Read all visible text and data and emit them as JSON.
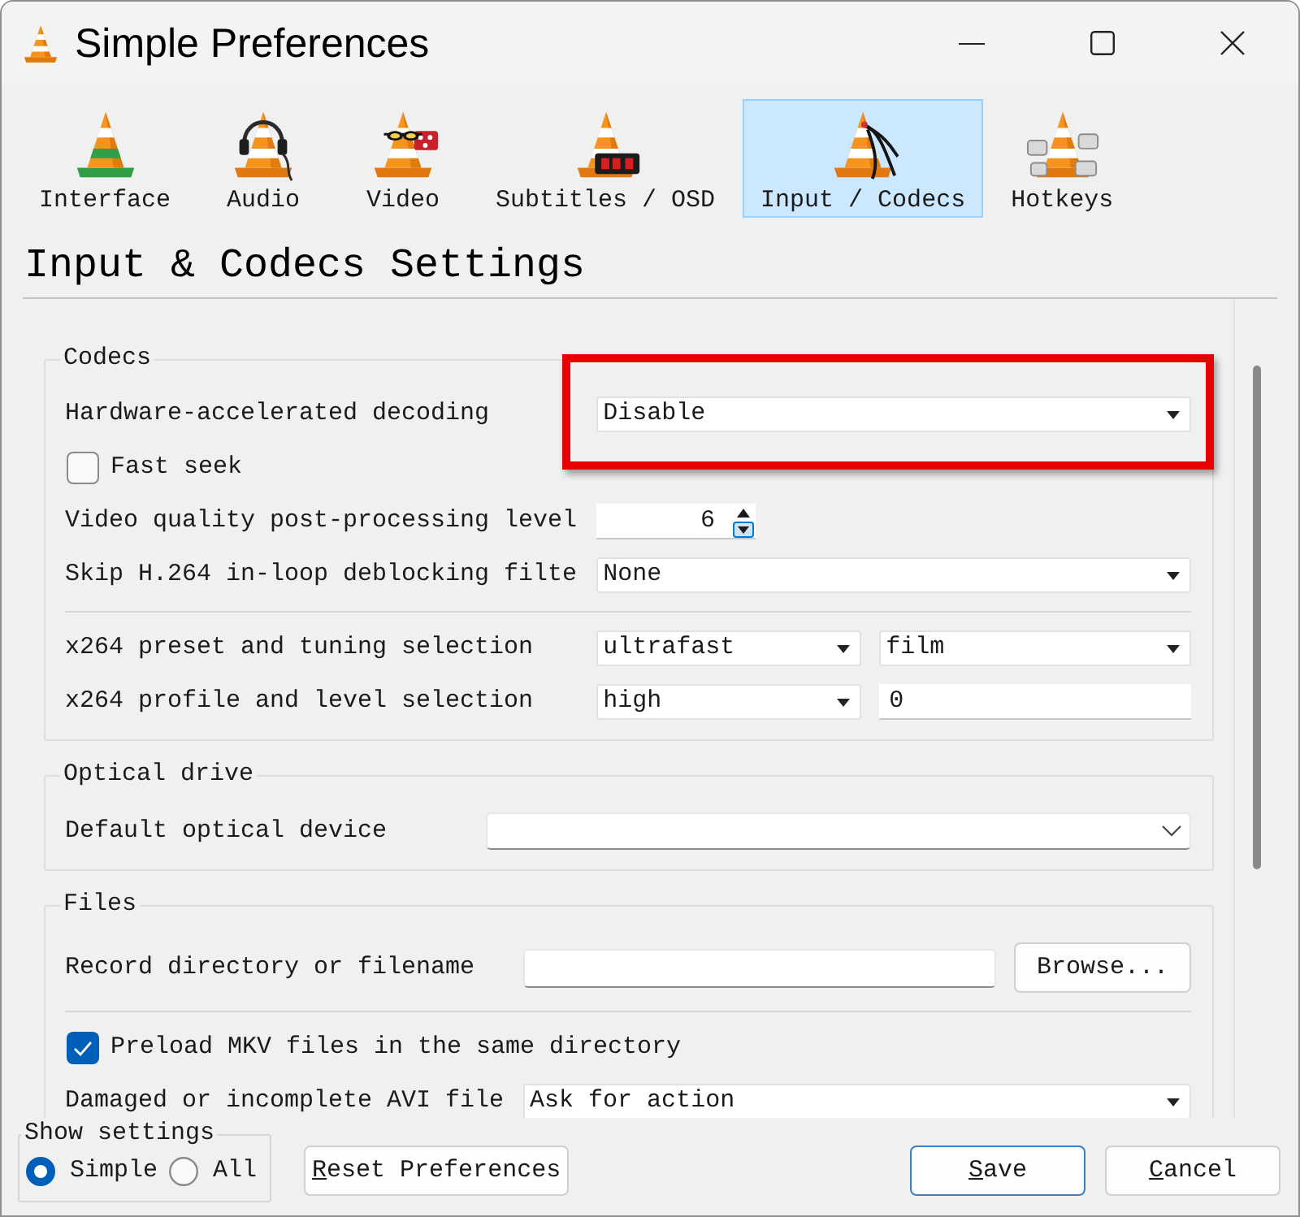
{
  "window": {
    "title": "Simple Preferences"
  },
  "tabs": [
    {
      "label": "Interface",
      "selected": false
    },
    {
      "label": "Audio",
      "selected": false
    },
    {
      "label": "Video",
      "selected": false
    },
    {
      "label": "Subtitles / OSD",
      "selected": false
    },
    {
      "label": "Input / Codecs",
      "selected": true
    },
    {
      "label": "Hotkeys",
      "selected": false
    }
  ],
  "heading": "Input & Codecs Settings",
  "groups": [
    {
      "title": "Codecs",
      "rows": [
        {
          "kind": "combo",
          "label": "Hardware-accelerated decoding",
          "value": "Disable",
          "highlighted": true
        },
        {
          "kind": "checkbox",
          "label": "Fast seek",
          "checked": false
        },
        {
          "kind": "spin",
          "label": "Video quality post-processing level",
          "value": "6"
        },
        {
          "kind": "combo",
          "label": "Skip H.264 in-loop deblocking filte",
          "value": "None"
        },
        {
          "kind": "combo_pair",
          "label": "x264 preset and tuning selection",
          "values": [
            "ultrafast",
            "film"
          ],
          "separator_before": true
        },
        {
          "kind": "combo_text",
          "label": "x264 profile and level selection",
          "value": "high",
          "text": "0"
        }
      ]
    },
    {
      "title": "Optical drive",
      "rows": [
        {
          "kind": "dropdown",
          "label": "Default optical device"
        }
      ]
    },
    {
      "title": "Files",
      "rows": [
        {
          "kind": "path",
          "label": "Record directory or filename",
          "button": "Browse..."
        },
        {
          "kind": "checkbox",
          "label": "Preload MKV files in the same directory",
          "checked": true,
          "separator_before": true
        },
        {
          "kind": "combo",
          "label": "Damaged or incomplete AVI file",
          "value": "Ask for action"
        }
      ]
    }
  ],
  "show_settings": {
    "title": "Show settings",
    "options": [
      {
        "label": "Simple",
        "selected": true
      },
      {
        "label": "All",
        "selected": false
      }
    ]
  },
  "footer": {
    "reset": "Reset Preferences",
    "buttons": [
      {
        "label": "Save",
        "default": true
      },
      {
        "label": "Cancel",
        "default": false
      }
    ]
  }
}
